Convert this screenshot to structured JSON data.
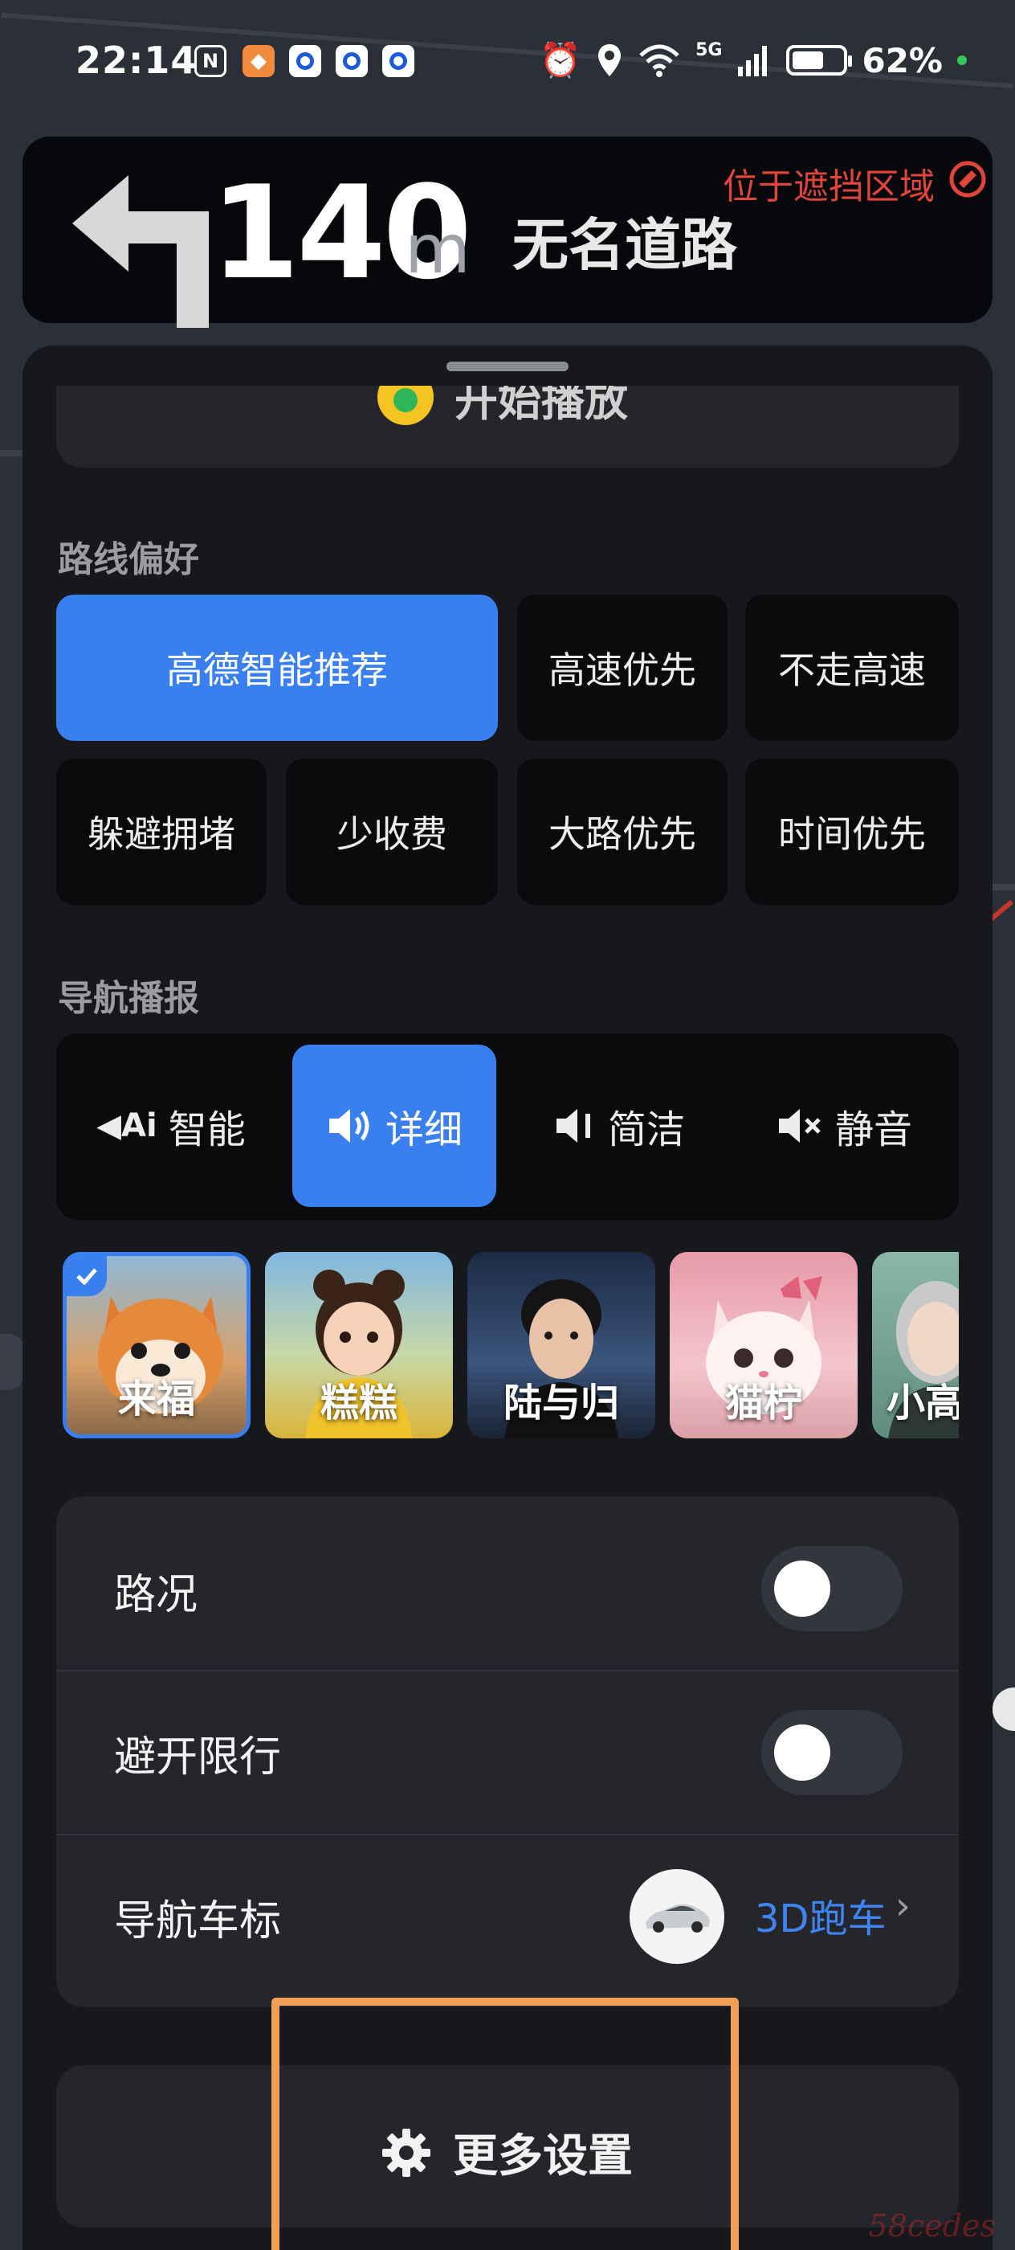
{
  "status_bar": {
    "time": "22:14",
    "battery_percent": "62%",
    "network": "5G",
    "battery_level": 0.62,
    "icons": [
      "nfc-icon",
      "app-shield-icon",
      "app-circle-icon",
      "app-circle-icon",
      "app-circle-icon",
      "alarm-icon",
      "location-icon",
      "wifi-icon",
      "signal-icon",
      "battery-icon"
    ]
  },
  "navigation": {
    "distance": "140",
    "unit": "m",
    "road_name": "无名道路",
    "warning": "位于遮挡区域",
    "turn_icon": "turn-left-arrow-icon"
  },
  "broadcast_card": {
    "label": "开始播放"
  },
  "route_preference": {
    "title": "路线偏好",
    "options": [
      {
        "label": "高德智能推荐",
        "selected": true
      },
      {
        "label": "高速优先",
        "selected": false
      },
      {
        "label": "不走高速",
        "selected": false
      },
      {
        "label": "躲避拥堵",
        "selected": false
      },
      {
        "label": "少收费",
        "selected": false
      },
      {
        "label": "大路优先",
        "selected": false
      },
      {
        "label": "时间优先",
        "selected": false
      }
    ]
  },
  "voice_broadcast": {
    "title": "导航播报",
    "modes": [
      {
        "label": "智能",
        "icon": "speaker-ai-icon",
        "selected": false
      },
      {
        "label": "详细",
        "icon": "speaker-loud-icon",
        "selected": true
      },
      {
        "label": "简洁",
        "icon": "speaker-low-icon",
        "selected": false
      },
      {
        "label": "静音",
        "icon": "speaker-mute-icon",
        "selected": false
      }
    ],
    "voices": [
      {
        "label": "来福",
        "selected": true
      },
      {
        "label": "糕糕",
        "selected": false
      },
      {
        "label": "陆与归",
        "selected": false
      },
      {
        "label": "猫柠",
        "selected": false
      },
      {
        "label": "小高",
        "selected": false
      }
    ]
  },
  "settings": {
    "traffic": {
      "label": "路况",
      "enabled": false
    },
    "avoid_restriction": {
      "label": "避开限行",
      "enabled": false
    },
    "vehicle_icon": {
      "label": "导航车标",
      "value": "3D跑车"
    }
  },
  "more_settings": {
    "label": "更多设置"
  },
  "watermark": "58cedes",
  "colors": {
    "accent": "#3a7ff0",
    "warning": "#e0453c",
    "highlight": "#f0a056"
  }
}
